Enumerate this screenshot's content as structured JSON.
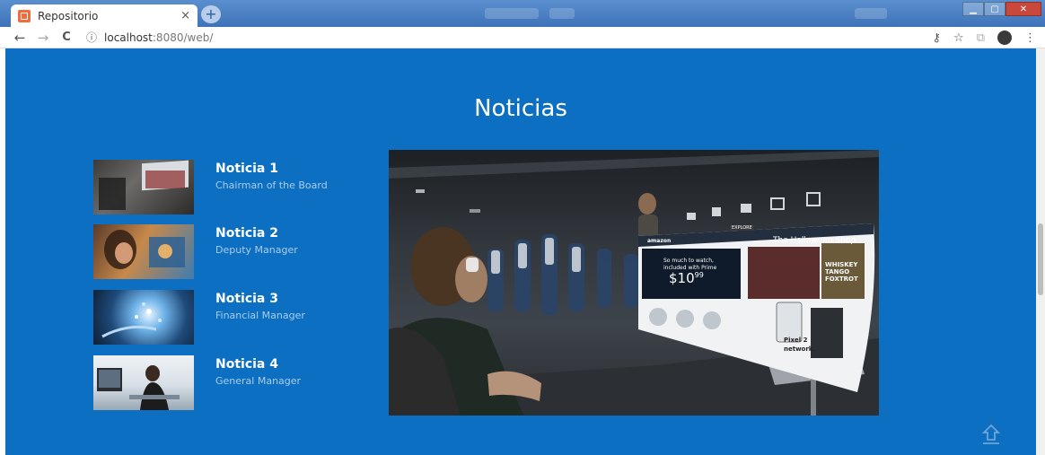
{
  "browser": {
    "tab_title": "Repositorio",
    "tab_close": "×",
    "new_tab": "+",
    "nav_back": "←",
    "nav_forward": "→",
    "nav_reload": "C",
    "url_info": "ⓘ",
    "url_host": "localhost",
    "url_path": ":8080/web/",
    "icons": [
      "key-icon",
      "star-icon",
      "extension-icon",
      "profile-icon",
      "menu-icon"
    ]
  },
  "page": {
    "heading": "Noticias",
    "background_color": "#0c6fc1",
    "news": [
      {
        "title": "Noticia 1",
        "subtitle": "Chairman of the Board"
      },
      {
        "title": "Noticia 2",
        "subtitle": "Deputy Manager"
      },
      {
        "title": "Noticia 3",
        "subtitle": "Financial Manager"
      },
      {
        "title": "Noticia 4",
        "subtitle": "General Manager"
      }
    ],
    "hero_screen": {
      "store": "amazon",
      "shop_title": "The Halloween Shop",
      "promo_line1": "So much to watch,",
      "promo_line2": "included with Prime",
      "price": "$10",
      "price_cents": "99",
      "brand_text": "WHISKEY TANGO FOXTROT",
      "phone_ad_line1": "Pixel 2",
      "phone_ad_line2": "network.",
      "button_text": "EXPLORE"
    }
  }
}
